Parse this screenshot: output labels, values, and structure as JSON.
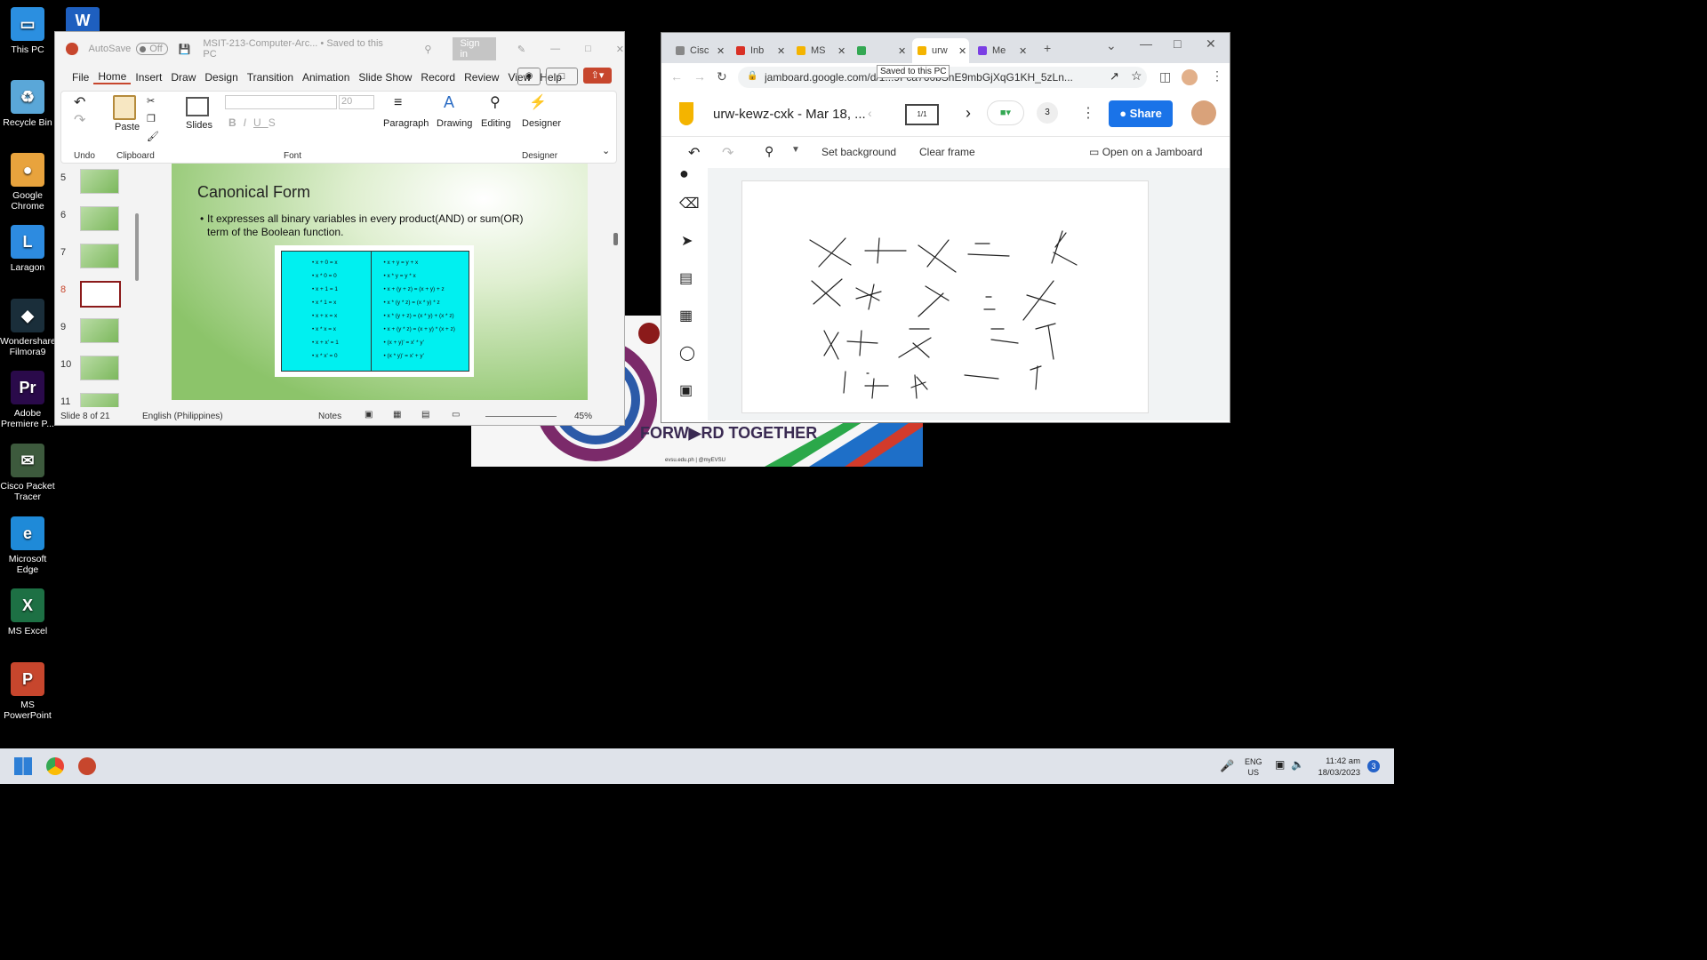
{
  "desktop": {
    "icons": [
      {
        "label": "This PC",
        "color": "#2b8fe0",
        "glyph": "▭"
      },
      {
        "label": "Recycle Bin",
        "color": "#5aa7d8",
        "glyph": "♻"
      },
      {
        "label": "Google Chrome",
        "color": "#e8a33d",
        "glyph": "●"
      },
      {
        "label": "Laragon",
        "color": "#2d8be0",
        "glyph": "L"
      },
      {
        "label": "Wondershare Filmora9",
        "color": "#1a2e3a",
        "glyph": "◆"
      },
      {
        "label": "Adobe Premiere P...",
        "color": "#2a0a4a",
        "glyph": "Pr"
      },
      {
        "label": "Cisco Packet Tracer",
        "color": "#3d5a3d",
        "glyph": "✉"
      },
      {
        "label": "Microsoft Edge",
        "color": "#1f8ad8",
        "glyph": "e"
      },
      {
        "label": "MS Excel",
        "color": "#1d7044",
        "glyph": "X"
      },
      {
        "label": "MS PowerPoint",
        "color": "#c7462d",
        "glyph": "P"
      }
    ],
    "word_icon": "W"
  },
  "taskbar": {
    "lang_line1": "ENG",
    "lang_line2": "US",
    "time": "11:42 am",
    "date": "18/03/2023",
    "notifications": "3"
  },
  "background_slide": {
    "banner": "FORWARD TOGETHER",
    "banner_prefix": "FORW",
    "banner_suffix": "RD TOGETHER",
    "footer": "evsu.edu.ph  |  @myEVSU"
  },
  "powerpoint": {
    "autosave_label": "AutoSave",
    "autosave_state": "Off",
    "file_title": "MSIT-213-Computer-Arc... • Saved to this PC",
    "signin": "Sign in",
    "tabs": [
      "File",
      "Home",
      "Insert",
      "Draw",
      "Design",
      "Transition",
      "Animation",
      "Slide Show",
      "Record",
      "Review",
      "View",
      "Help"
    ],
    "active_tab": "Home",
    "ribbon": {
      "undo": "Undo",
      "paste": "Paste",
      "clipboard": "Clipboard",
      "slides": "Slides",
      "font": "Font",
      "font_size": "20",
      "paragraph": "Paragraph",
      "drawing": "Drawing",
      "editing": "Editing",
      "designer": "Designer",
      "designer_group": "Designer"
    },
    "thumb_numbers": [
      "5",
      "6",
      "7",
      "8",
      "9",
      "10",
      "11"
    ],
    "active_slide": "8",
    "slide": {
      "title": "Canonical Form",
      "bullet": "It expresses all binary variables in every product(AND) or sum(OR) term of the Boolean function.",
      "left_rules": [
        "x + 0 = x",
        "x * 0 = 0",
        "x + 1 = 1",
        "x * 1 = x",
        "x + x = x",
        "x * x = x",
        "x + x' = 1",
        "x * x' = 0"
      ],
      "right_rules": [
        "x + y = y + x",
        "x * y = y * x",
        "x + (y + z) = (x + y) + z",
        "x * (y * z) = (x * y) * z",
        "x * (y + z) = (x * y) + (x * z)",
        "x + (y * z) = (x + y) * (x + z)",
        "(x + y)' = x' * y'",
        "(x * y)' = x' + y'"
      ]
    },
    "status": {
      "slide_info": "Slide 8 of 21",
      "language": "English (Philippines)",
      "notes": "Notes",
      "zoom": "45%"
    },
    "tooltip": "Saved to this PC"
  },
  "chrome": {
    "tabs": [
      {
        "label": "Cisc",
        "color": "#888"
      },
      {
        "label": "Inb",
        "color": "#d93025"
      },
      {
        "label": "MS",
        "color": "#f4b400"
      },
      {
        "label": "",
        "color": "#34a853"
      },
      {
        "label": "urw",
        "color": "#f4b400"
      },
      {
        "label": "Me",
        "color": "#7b3fe4"
      }
    ],
    "url": "jamboard.google.com/d/1...9Fca760bSnE9mbGjXqG1KH_5zLn...",
    "jam_title": "urw-kewz-cxk - Mar 18, ...",
    "frame": "1/1",
    "participants": "3",
    "share": "Share",
    "toolbar": {
      "set_background": "Set background",
      "clear_frame": "Clear frame",
      "open_on_jamboard": "Open on a Jamboard"
    }
  }
}
